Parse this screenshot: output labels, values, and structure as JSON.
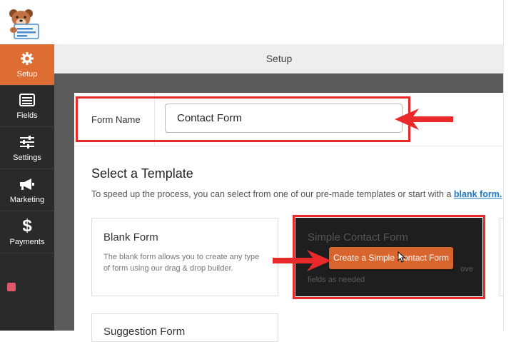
{
  "sidebar": {
    "items": [
      {
        "label": "Setup",
        "icon": "gear-icon",
        "active": true
      },
      {
        "label": "Fields",
        "icon": "fields-list-icon"
      },
      {
        "label": "Settings",
        "icon": "sliders-icon"
      },
      {
        "label": "Marketing",
        "icon": "megaphone-icon"
      },
      {
        "label": "Payments",
        "icon": "dollar-icon"
      }
    ]
  },
  "header": {
    "title": "Setup"
  },
  "form_name": {
    "label": "Form Name",
    "value": "Contact Form"
  },
  "templates": {
    "title": "Select a Template",
    "description": "To speed up the process, you can select from one of our pre-made templates or start with a",
    "blank_link": "blank form.",
    "cards": [
      {
        "title": "Blank Form",
        "text": "The blank form allows you to create any type of form using our drag & drop builder."
      },
      {
        "title": "Simple Contact Form",
        "text": "fields as needed",
        "text_partial": "ove",
        "button": "Create a Simple Contact Form"
      },
      {
        "title": "Suggestion Form"
      }
    ]
  },
  "colors": {
    "accent": "#dd6d33",
    "sidebar": "#2a2a2b",
    "annotation": "#ea2a2a",
    "link": "#1f78c2"
  }
}
